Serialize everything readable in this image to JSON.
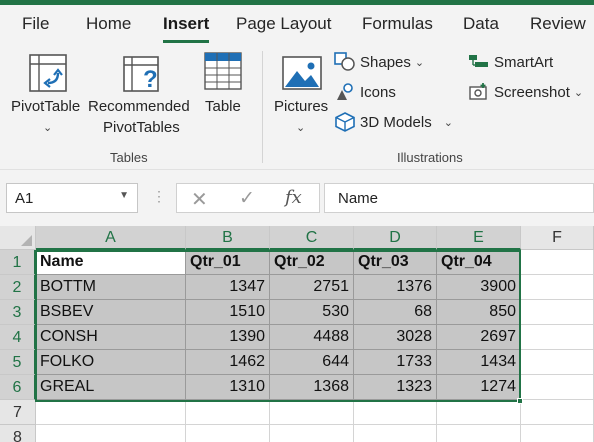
{
  "menu": {
    "tabs": [
      {
        "label": "File"
      },
      {
        "label": "Home"
      },
      {
        "label": "Insert"
      },
      {
        "label": "Page Layout"
      },
      {
        "label": "Formulas"
      },
      {
        "label": "Data"
      },
      {
        "label": "Review"
      }
    ],
    "active_tab": "Insert",
    "accent_color": "#217346"
  },
  "ribbon": {
    "tables_group": {
      "label": "Tables",
      "pivot_table": "PivotTable",
      "recommended_line1": "Recommended",
      "recommended_line2": "PivotTables",
      "table": "Table"
    },
    "illustrations_group": {
      "label": "Illustrations",
      "pictures": "Pictures",
      "shapes": "Shapes",
      "icons": "Icons",
      "models_3d": "3D Models",
      "smartart": "SmartArt",
      "screenshot": "Screenshot"
    }
  },
  "formula_bar": {
    "name_box": "A1",
    "cancel_glyph": "✕",
    "enter_glyph": "✓",
    "fx_label": "fx",
    "content": "Name"
  },
  "sheet": {
    "columns": [
      "A",
      "B",
      "C",
      "D",
      "E",
      "F"
    ],
    "rows": [
      "1",
      "2",
      "3",
      "4",
      "5",
      "6",
      "7",
      "8"
    ],
    "header": [
      "Name",
      "Qtr_01",
      "Qtr_02",
      "Qtr_03",
      "Qtr_04"
    ],
    "data": [
      [
        "BOTTM",
        "1347",
        "2751",
        "1376",
        "3900"
      ],
      [
        "BSBEV",
        "1510",
        "530",
        "68",
        "850"
      ],
      [
        "CONSH",
        "1390",
        "4488",
        "3028",
        "2697"
      ],
      [
        "FOLKO",
        "1462",
        "644",
        "1733",
        "1434"
      ],
      [
        "GREAL",
        "1310",
        "1368",
        "1323",
        "1274"
      ]
    ],
    "selected_range": "A1:E6"
  }
}
